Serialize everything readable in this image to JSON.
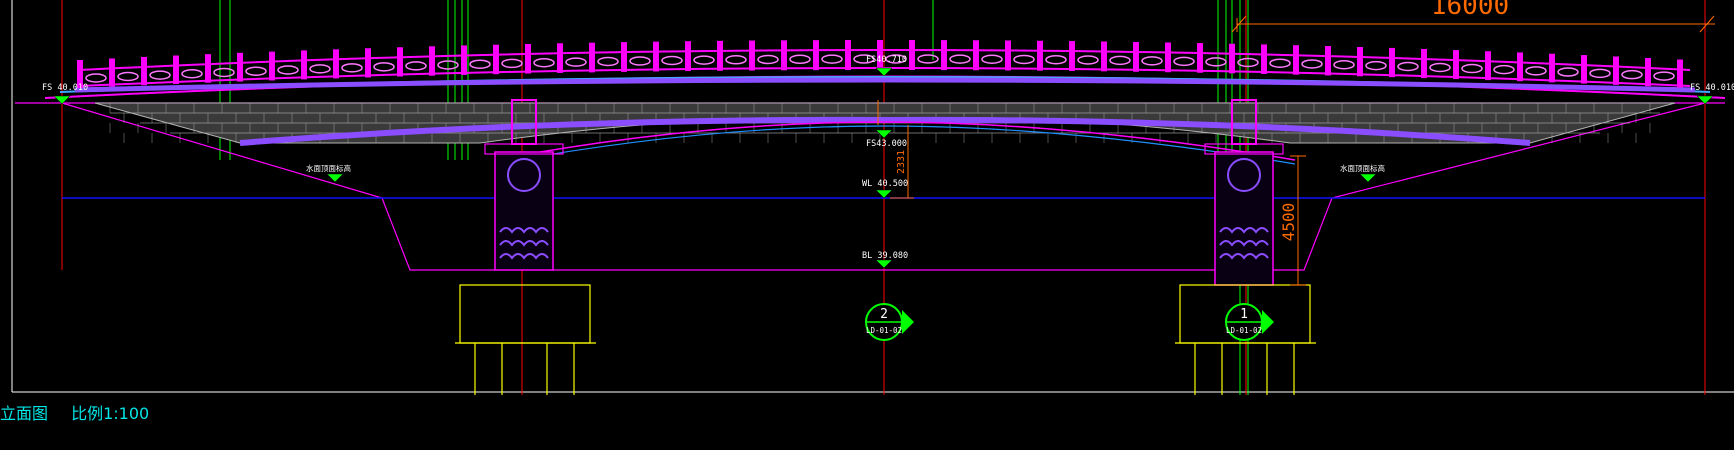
{
  "drawing": {
    "colors": {
      "background": "#000000",
      "railing": "#ff00ff",
      "masonry": "#b4b4b4",
      "waterline": "#1010ff",
      "gridline_red": "#ff0000",
      "gridline_green": "#00ff00",
      "foundation": "#ffff00",
      "annotation": "#ffffff",
      "marker": "#00ff00",
      "dimension": "#ff6a00",
      "caption": "#00e5e5"
    },
    "labels": {
      "deck_left": "FS 40.010",
      "deck_center": "FS40.710",
      "deck_right": "FS 40.010",
      "arch_crown": "FS43.000",
      "water_level": "WL 40.500",
      "bed_level": "BL 39.080",
      "bank_left": "水面顶面标高",
      "bank_right": "水面顶面标高"
    },
    "dimensions": {
      "span_top": "16000",
      "pier_height": "4500",
      "crown_thickness": "2331"
    },
    "section_markers": [
      {
        "number": "2",
        "sheet": "LD-01-02",
        "icon": "section-arrow-right-icon"
      },
      {
        "number": "1",
        "sheet": "LD-01-02",
        "icon": "section-arrow-right-icon"
      }
    ]
  },
  "caption": {
    "title": "立面图",
    "scale": "比例1:100"
  }
}
